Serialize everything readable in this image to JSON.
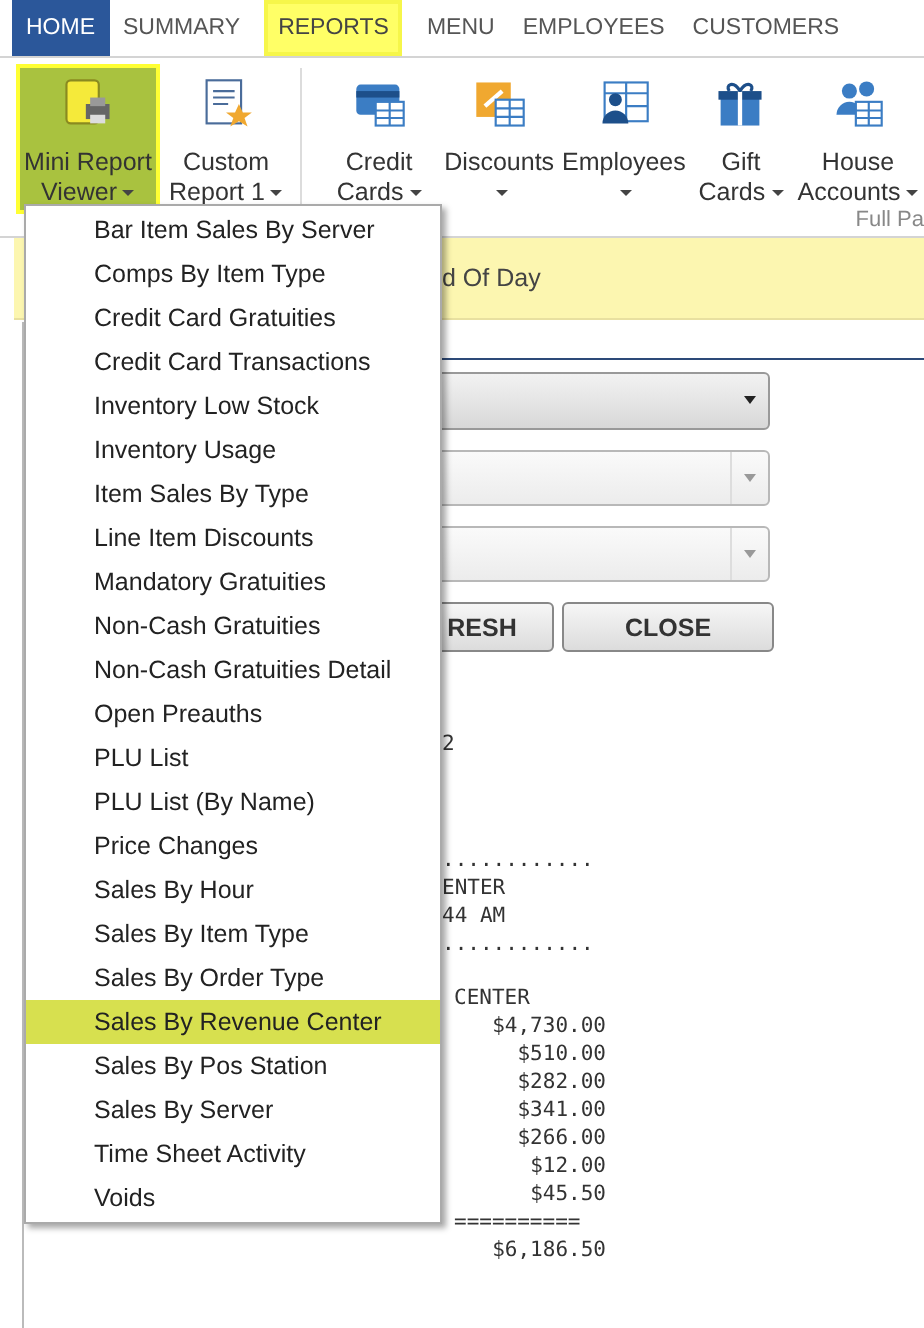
{
  "tabs": [
    {
      "label": "HOME",
      "selected": true,
      "highlighted": false
    },
    {
      "label": "SUMMARY",
      "selected": false,
      "highlighted": false
    },
    {
      "label": "REPORTS",
      "selected": false,
      "highlighted": true
    },
    {
      "label": "MENU",
      "selected": false,
      "highlighted": false
    },
    {
      "label": "EMPLOYEES",
      "selected": false,
      "highlighted": false
    },
    {
      "label": "CUSTOMERS",
      "selected": false,
      "highlighted": false
    }
  ],
  "ribbon": {
    "buttons": [
      {
        "label": "Mini Report Viewer",
        "highlighted": true
      },
      {
        "label": "Custom Report 1",
        "highlighted": false
      },
      {
        "label": "Credit Cards",
        "highlighted": false
      },
      {
        "label": "Discounts",
        "highlighted": false
      },
      {
        "label": "Employees",
        "highlighted": false
      },
      {
        "label": "Gift Cards",
        "highlighted": false
      },
      {
        "label": "House Accounts",
        "highlighted": false
      }
    ],
    "group_label": "Full Pa"
  },
  "banner": {
    "text": "d Of Day"
  },
  "dropdowns": [
    {
      "active": true
    },
    {
      "active": false
    },
    {
      "active": false
    }
  ],
  "buttons": [
    "RESH",
    "CLOSE"
  ],
  "report": {
    "header_lines": [
      "2",
      "............",
      "ENTER",
      "44 AM",
      "............"
    ],
    "table_heading": "CENTER",
    "amounts": [
      "$4,730.00",
      "$510.00",
      "$282.00",
      "$341.00",
      "$266.00",
      "$12.00",
      "$45.50"
    ],
    "rule": "==========",
    "total": "$6,186.50"
  },
  "menu": {
    "items": [
      {
        "label": "Bar Item Sales By Server",
        "selected": false
      },
      {
        "label": "Comps By Item Type",
        "selected": false
      },
      {
        "label": "Credit Card Gratuities",
        "selected": false
      },
      {
        "label": "Credit Card Transactions",
        "selected": false
      },
      {
        "label": "Inventory Low Stock",
        "selected": false
      },
      {
        "label": "Inventory Usage",
        "selected": false
      },
      {
        "label": "Item Sales By Type",
        "selected": false
      },
      {
        "label": "Line Item Discounts",
        "selected": false
      },
      {
        "label": "Mandatory Gratuities",
        "selected": false
      },
      {
        "label": "Non-Cash Gratuities",
        "selected": false
      },
      {
        "label": "Non-Cash Gratuities Detail",
        "selected": false
      },
      {
        "label": "Open Preauths",
        "selected": false
      },
      {
        "label": "PLU List",
        "selected": false
      },
      {
        "label": "PLU List (By Name)",
        "selected": false
      },
      {
        "label": "Price Changes",
        "selected": false
      },
      {
        "label": "Sales By Hour",
        "selected": false
      },
      {
        "label": "Sales By Item Type",
        "selected": false
      },
      {
        "label": "Sales By Order Type",
        "selected": false
      },
      {
        "label": "Sales By Revenue Center",
        "selected": true
      },
      {
        "label": "Sales By Pos Station",
        "selected": false
      },
      {
        "label": "Sales By Server",
        "selected": false
      },
      {
        "label": "Time Sheet Activity",
        "selected": false
      },
      {
        "label": "Voids",
        "selected": false
      }
    ]
  }
}
